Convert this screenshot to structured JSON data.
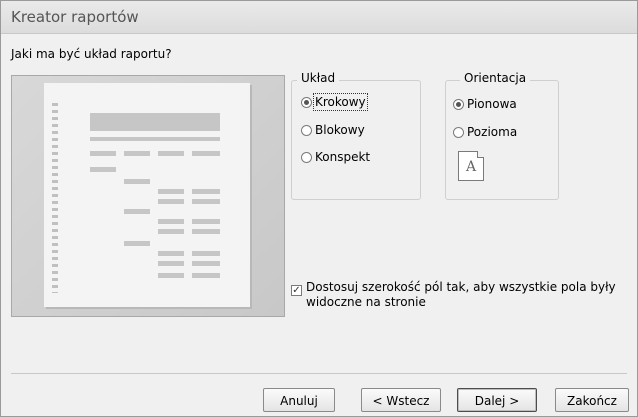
{
  "window": {
    "title": "Kreator raportów"
  },
  "question": "Jaki ma być układ raportu?",
  "layout": {
    "legend": "Układ",
    "options": [
      {
        "label": "Krokowy",
        "selected": true
      },
      {
        "label": "Blokowy",
        "selected": false
      },
      {
        "label": "Konspekt",
        "selected": false
      }
    ]
  },
  "orientation": {
    "legend": "Orientacja",
    "options": [
      {
        "label": "Pionowa",
        "selected": true
      },
      {
        "label": "Pozioma",
        "selected": false
      }
    ],
    "icon_letter": "A"
  },
  "adjust_width": {
    "checked": true,
    "label": "Dostosuj szerokość pól tak, aby wszystkie pola były widoczne na stronie"
  },
  "buttons": {
    "cancel": "Anuluj",
    "back": "< Wstecz",
    "next": "Dalej >",
    "finish": "Zakończ"
  }
}
